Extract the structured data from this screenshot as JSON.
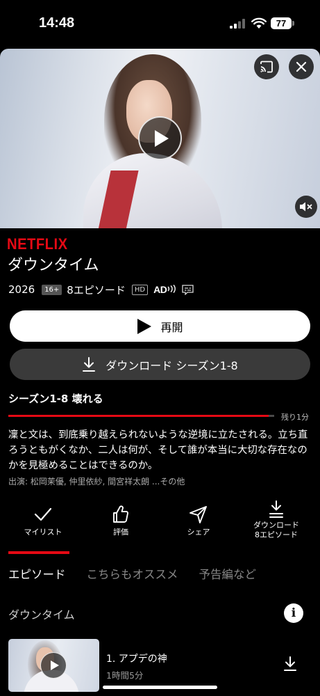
{
  "status_bar": {
    "time": "14:48",
    "battery": "77",
    "icons": [
      "cellular-signal-icon",
      "wifi-icon",
      "battery-icon"
    ]
  },
  "hero": {
    "controls": [
      "cast-icon",
      "close-icon",
      "play-icon",
      "mute-icon"
    ]
  },
  "brand": {
    "logo": "NETFLIX",
    "color": "#e50914"
  },
  "title": "ダウンタイム",
  "meta": {
    "year": "2026",
    "rating": "16+",
    "episodes": "8エピソード",
    "quality": "HD",
    "audio_description": "AD",
    "subtitles_icon": "subtitles-icon"
  },
  "buttons": {
    "resume": "再開",
    "download": "ダウンロード シーズン1-8"
  },
  "current_episode": {
    "heading": "シーズン1-8 壊れる",
    "progress": 0.98,
    "remaining": "残り1分"
  },
  "synopsis": "凜と文は、到底乗り越えられないような逆境に立たされる。立ち直ろうともがくなか、二人は何が、そして誰が本当に大切な存在なのかを見極めることはできるのか。",
  "cast": "出演: 松岡茉優, 仲里依紗, 間宮祥太朗 ...その他",
  "actions": [
    {
      "label": "マイリスト",
      "icon": "check-icon"
    },
    {
      "label": "評価",
      "icon": "thumbs-up-icon"
    },
    {
      "label": "シェア",
      "icon": "share-icon"
    },
    {
      "label": "ダウンロード",
      "sublabel": "8エピソード",
      "icon": "download-icon"
    }
  ],
  "tabs": [
    {
      "label": "エピソード",
      "active": true
    },
    {
      "label": "こちらもオススメ",
      "active": false
    },
    {
      "label": "予告編など",
      "active": false
    }
  ],
  "season_label": "ダウンタイム",
  "episodes": [
    {
      "title": "1. アプデの神",
      "duration": "1時間5分"
    }
  ]
}
